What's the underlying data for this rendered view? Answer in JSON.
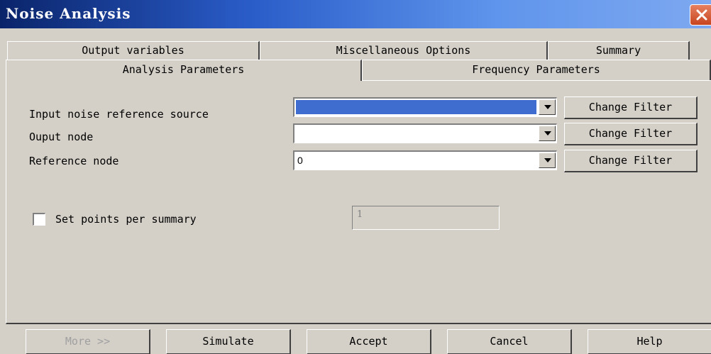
{
  "window": {
    "title": "Noise Analysis"
  },
  "tabs": {
    "back_row": [
      "Output variables",
      "Miscellaneous Options",
      "Summary"
    ],
    "front_row": [
      "Analysis Parameters",
      "Frequency Parameters"
    ],
    "active": "Analysis Parameters"
  },
  "params": {
    "input_noise_label": "Input noise reference source",
    "input_noise_value": "",
    "output_node_label": "Ouput node",
    "output_node_value": "",
    "reference_node_label": "Reference node",
    "reference_node_value": "0",
    "change_filter_label": "Change Filter"
  },
  "summary_points": {
    "checkbox_label": "Set points per summary",
    "checked": false,
    "value": "1"
  },
  "buttons": {
    "more": "More >>",
    "simulate": "Simulate",
    "accept": "Accept",
    "cancel": "Cancel",
    "help": "Help"
  },
  "colors": {
    "titlebar_start": "#0a246a",
    "titlebar_end": "#7ea8f0",
    "selection": "#3e6ccf",
    "dialog_bg": "#d4d0c8"
  }
}
